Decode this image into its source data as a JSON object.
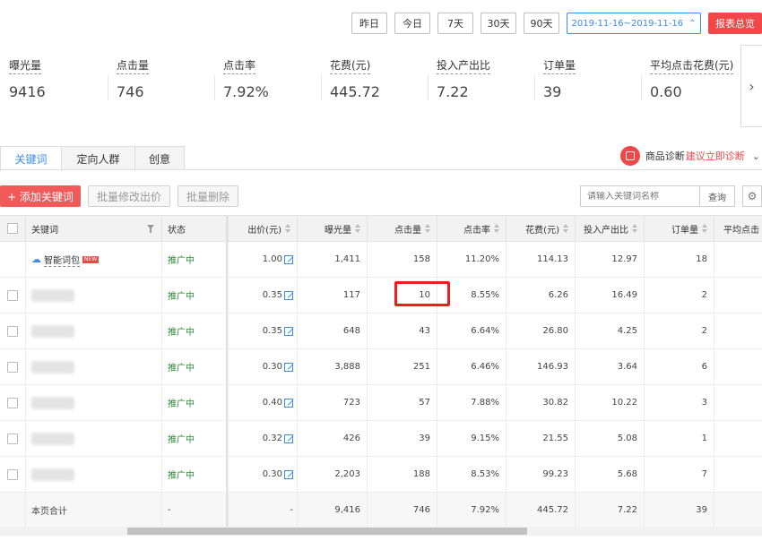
{
  "date_buttons": [
    "昨日",
    "今日",
    "7天",
    "30天",
    "90天"
  ],
  "date_range": "2019-11-16~2019-11-16",
  "report_button": "报表总览",
  "metrics": [
    {
      "label": "曝光量",
      "value": "9416"
    },
    {
      "label": "点击量",
      "value": "746"
    },
    {
      "label": "点击率",
      "value": "7.92%"
    },
    {
      "label": "花费(元)",
      "value": "445.72"
    },
    {
      "label": "投入产出比",
      "value": "7.22"
    },
    {
      "label": "订单量",
      "value": "39"
    },
    {
      "label": "平均点击花费(元)",
      "value": "0.60"
    }
  ],
  "next_icon": "chevron-right-icon",
  "tabs": [
    "关键词",
    "定向人群",
    "创意"
  ],
  "diagnosis": {
    "label": "商品诊断",
    "link": "建议立即诊断"
  },
  "toolbar": {
    "add_keyword": "+ 添加关键词",
    "batch_edit_bid": "批量修改出价",
    "batch_delete": "批量删除",
    "search_placeholder": "请输入关键词名称",
    "search_button": "查询"
  },
  "table": {
    "headers": [
      "关键词",
      "状态",
      "出价(元)",
      "曝光量",
      "点击量",
      "点击率",
      "花费(元)",
      "投入产出比",
      "订单量",
      "平均点击"
    ],
    "rows": [
      {
        "keyword": "智能词包",
        "new_badge": "NEW",
        "status": "推广中",
        "bid": "1.00",
        "impressions": "1,411",
        "clicks": "158",
        "ctr": "11.20%",
        "cost": "114.13",
        "roi": "12.97",
        "orders": "18"
      },
      {
        "keyword": "",
        "status": "推广中",
        "bid": "0.35",
        "impressions": "117",
        "clicks": "10",
        "ctr": "8.55%",
        "cost": "6.26",
        "roi": "16.49",
        "orders": "2"
      },
      {
        "keyword": "",
        "status": "推广中",
        "bid": "0.35",
        "impressions": "648",
        "clicks": "43",
        "ctr": "6.64%",
        "cost": "26.80",
        "roi": "4.25",
        "orders": "2"
      },
      {
        "keyword": "",
        "status": "推广中",
        "bid": "0.30",
        "impressions": "3,888",
        "clicks": "251",
        "ctr": "6.46%",
        "cost": "146.93",
        "roi": "3.64",
        "orders": "6"
      },
      {
        "keyword": "",
        "status": "推广中",
        "bid": "0.40",
        "impressions": "723",
        "clicks": "57",
        "ctr": "7.88%",
        "cost": "30.82",
        "roi": "10.22",
        "orders": "3"
      },
      {
        "keyword": "",
        "status": "推广中",
        "bid": "0.32",
        "impressions": "426",
        "clicks": "39",
        "ctr": "9.15%",
        "cost": "21.55",
        "roi": "5.08",
        "orders": "1"
      },
      {
        "keyword": "",
        "status": "推广中",
        "bid": "0.30",
        "impressions": "2,203",
        "clicks": "188",
        "ctr": "8.53%",
        "cost": "99.23",
        "roi": "5.68",
        "orders": "7"
      }
    ],
    "total": {
      "label": "本页合计",
      "status": "-",
      "bid": "-",
      "impressions": "9,416",
      "clicks": "746",
      "ctr": "7.92%",
      "cost": "445.72",
      "roi": "7.22",
      "orders": "39"
    }
  },
  "colors": {
    "accent": "#3c8be8",
    "danger": "#f04848",
    "status_green": "#2a8c3a"
  }
}
